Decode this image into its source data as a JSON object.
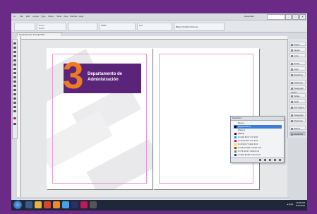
{
  "app": {
    "menus": [
      "Ai",
      "File",
      "Edit",
      "Layout",
      "Type",
      "Object",
      "Table",
      "View",
      "Window",
      "Help"
    ],
    "workspace": "Essentials",
    "window_buttons": [
      "–",
      "□",
      "✕"
    ]
  },
  "control_bar": {
    "x": "0 mm",
    "y": "0 mm",
    "w": "",
    "h": "",
    "zoom": "100%",
    "stroke": "0 pt",
    "style": "[Basic Graphics Frame]"
  },
  "document": {
    "tab": "Departamento.indd @ 50%",
    "status": "1"
  },
  "page1": {
    "number": "3",
    "title_line1": "Departamento de",
    "title_line2": "Administración",
    "accent_color": "#ef7a22",
    "banner_color": "#5a2578"
  },
  "dock": {
    "items": [
      "Pages",
      "Layers",
      "Links",
      "Stroke",
      "Color",
      "Swatches",
      "Character Styles",
      "Paragraph Styles",
      "Tables",
      "Table Styles",
      "Cell Styles",
      "Paragraph",
      "Character",
      "Effects",
      "Swatches"
    ]
  },
  "swatches_panel": {
    "tabs": "Swatches",
    "rows": [
      {
        "name": "[None]",
        "value": "",
        "color": "#ffffff"
      },
      {
        "name": "[Registration]",
        "value": "",
        "color": "#000000"
      },
      {
        "name": "[Paper]",
        "value": "",
        "color": "#ffffff"
      },
      {
        "name": "[Black]",
        "value": "",
        "color": "#222222"
      },
      {
        "name": "C=100 M=0 Y=0 K=0",
        "value": "",
        "color": "#00a0e0"
      },
      {
        "name": "C=0 M=100 Y=0 K=0",
        "value": "",
        "color": "#e0007a"
      },
      {
        "name": "C=0 M=0 Y=100 K=0",
        "value": "",
        "color": "#ffe600"
      },
      {
        "name": "C=15 M=100 Y=100 K=0",
        "value": "",
        "color": "#c8202a"
      },
      {
        "name": "C=75 M=5 Y=100 K=0",
        "value": "",
        "color": "#3aa33a"
      },
      {
        "name": "C=100 M=90 Y=10 K=0",
        "value": "",
        "color": "#2a3d8f"
      }
    ]
  },
  "taskbar": {
    "time": "10:28 PM",
    "date": "6/11/2016"
  }
}
